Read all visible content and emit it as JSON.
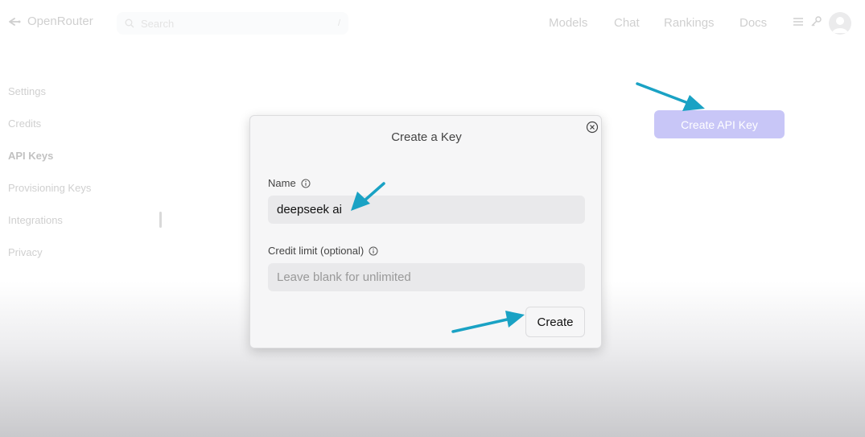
{
  "header": {
    "brand": "OpenRouter",
    "search_placeholder": "Search",
    "search_shortcut": "/",
    "nav": [
      "Models",
      "Chat",
      "Rankings",
      "Docs"
    ]
  },
  "sidebar": {
    "items": [
      "Settings",
      "Credits",
      "API Keys",
      "Provisioning Keys",
      "Integrations",
      "Privacy"
    ],
    "active": "API Keys"
  },
  "main": {
    "create_api_key_label": "Create API Key"
  },
  "modal": {
    "title": "Create a Key",
    "name_label": "Name",
    "name_value": "deepseek ai",
    "credit_label": "Credit limit (optional)",
    "credit_placeholder": "Leave blank for unlimited",
    "create_label": "Create"
  },
  "colors": {
    "accent_button": "#c8c6f7",
    "annotation_arrow": "#1aa2c4"
  }
}
